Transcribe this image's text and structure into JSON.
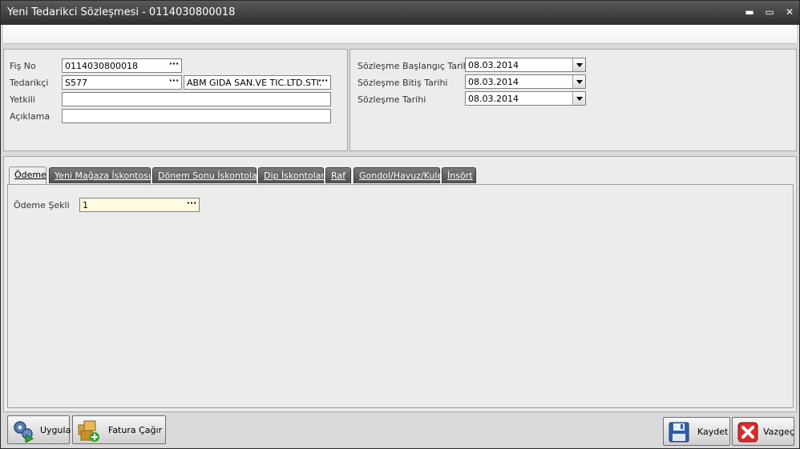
{
  "window": {
    "title": "Yeni Tedarikci Sözleşmesi - 0114030800018",
    "minimize": "▬",
    "maximize": "▭",
    "close": "✕"
  },
  "header": {
    "fis_no": {
      "label": "Fiş No",
      "value": "0114030800018"
    },
    "tedarikci": {
      "label": "Tedarikçi",
      "code": "S577",
      "name": "ABM GIDA SAN.VE TIC.LTD.STI."
    },
    "yetkili": {
      "label": "Yetkili",
      "value": ""
    },
    "aciklama": {
      "label": "Açıklama",
      "value": ""
    },
    "baslangic": {
      "label": "Sözleşme Başlangıç Tarihi",
      "value": "08.03.2014"
    },
    "bitis": {
      "label": "Sözleşme Bitiş Tarihi",
      "value": "08.03.2014"
    },
    "tarih": {
      "label": "Sözleşme Tarihi",
      "value": "08.03.2014"
    },
    "ellipsis": "···"
  },
  "tabs": [
    {
      "label": "Ödeme",
      "active": true
    },
    {
      "label": "Yeni Mağaza İskontosu",
      "active": false
    },
    {
      "label": "Dönem Sonu İskontoları",
      "active": false
    },
    {
      "label": "Dip İskontolar",
      "active": false
    },
    {
      "label": "Raf",
      "active": false
    },
    {
      "label": "Gondol/Havuz/Kule",
      "active": false
    },
    {
      "label": "İnsört",
      "active": false
    }
  ],
  "odeme": {
    "label": "Ödeme Şekli",
    "value": "1"
  },
  "buttons": {
    "uygula": "Uygula",
    "fatura": "Fatura Çağır",
    "kaydet": "Kaydet",
    "vazgec": "Vazgeç"
  },
  "icons": {
    "uygula": "gears-play-icon",
    "fatura": "boxes-add-icon",
    "kaydet": "floppy-disk-icon",
    "vazgec": "red-x-icon"
  }
}
